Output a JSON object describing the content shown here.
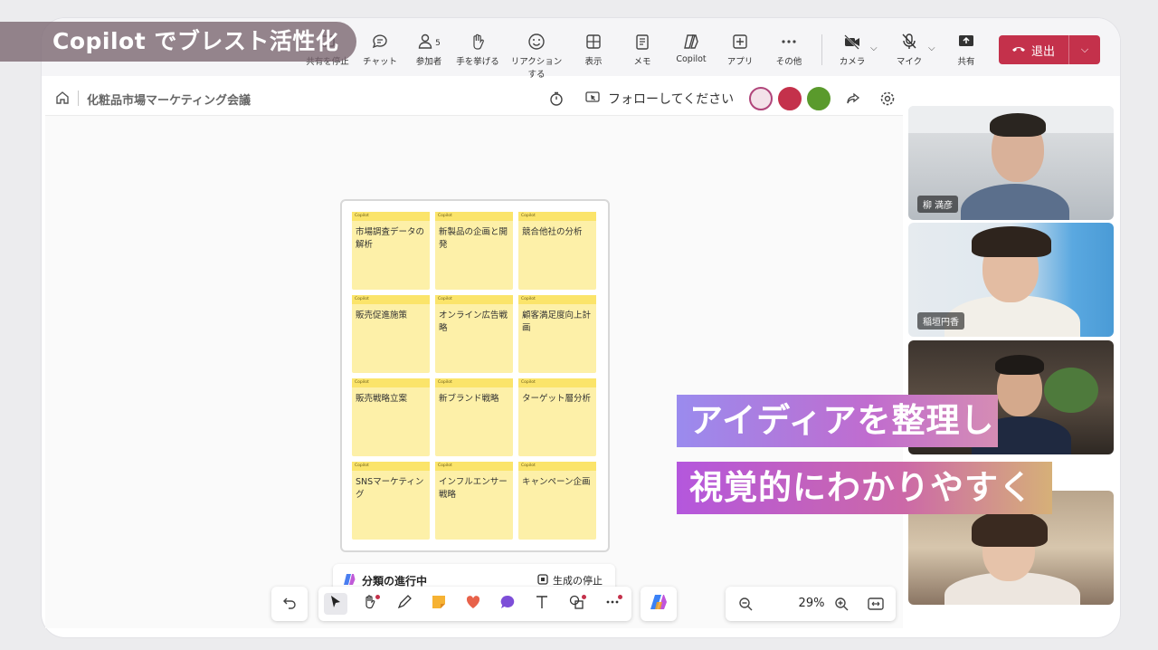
{
  "overlay_title": "Copilot でブレスト活性化",
  "toolbar": {
    "items": [
      {
        "label": "共有を停止",
        "icon": "share-stop-icon"
      },
      {
        "label": "チャット",
        "icon": "chat-icon"
      },
      {
        "label": "参加者",
        "icon": "people-icon",
        "count": "5"
      },
      {
        "label": "手を挙げる",
        "icon": "raise-hand-icon"
      },
      {
        "label": "リアクションする",
        "icon": "emoji-icon"
      },
      {
        "label": "表示",
        "icon": "view-grid-icon"
      },
      {
        "label": "メモ",
        "icon": "notes-icon"
      },
      {
        "label": "Copilot",
        "icon": "copilot-icon"
      },
      {
        "label": "アプリ",
        "icon": "apps-icon"
      },
      {
        "label": "その他",
        "icon": "more-icon"
      },
      {
        "label": "カメラ",
        "icon": "camera-off-icon"
      },
      {
        "label": "マイク",
        "icon": "mic-off-icon"
      },
      {
        "label": "共有",
        "icon": "share-icon"
      }
    ],
    "leave_label": "退出",
    "leave_color": "#c4314b"
  },
  "whiteboard": {
    "title": "化粧品市場マーケティング会議",
    "follow_label": "フォローしてください",
    "avatar_colors": [
      "#b0457a",
      "#c4314b",
      "#5a9a2c"
    ]
  },
  "notes": {
    "header": "Copilot",
    "items": [
      "市場調査データの解析",
      "新製品の企画と開発",
      "競合他社の分析",
      "販売促進施策",
      "オンライン広告戦略",
      "顧客満足度向上計画",
      "販売戦略立案",
      "新ブランド戦略",
      "ターゲット層分析",
      "SNSマーケティング",
      "インフルエンサー戦略",
      "キャンペーン企画"
    ],
    "note_color": "#fdf0a8",
    "strip_color": "#fbe46a"
  },
  "status": {
    "progress_label": "分類の進行中",
    "stop_label": "生成の停止"
  },
  "zoom": {
    "value": "29%"
  },
  "participants": [
    {
      "name": "柳 満彦"
    },
    {
      "name": "稲垣円香"
    },
    {
      "name": ""
    },
    {
      "name": ""
    }
  ],
  "captions": {
    "line1": "アイディアを整理し",
    "line2": "視覚的にわかりやすく"
  }
}
